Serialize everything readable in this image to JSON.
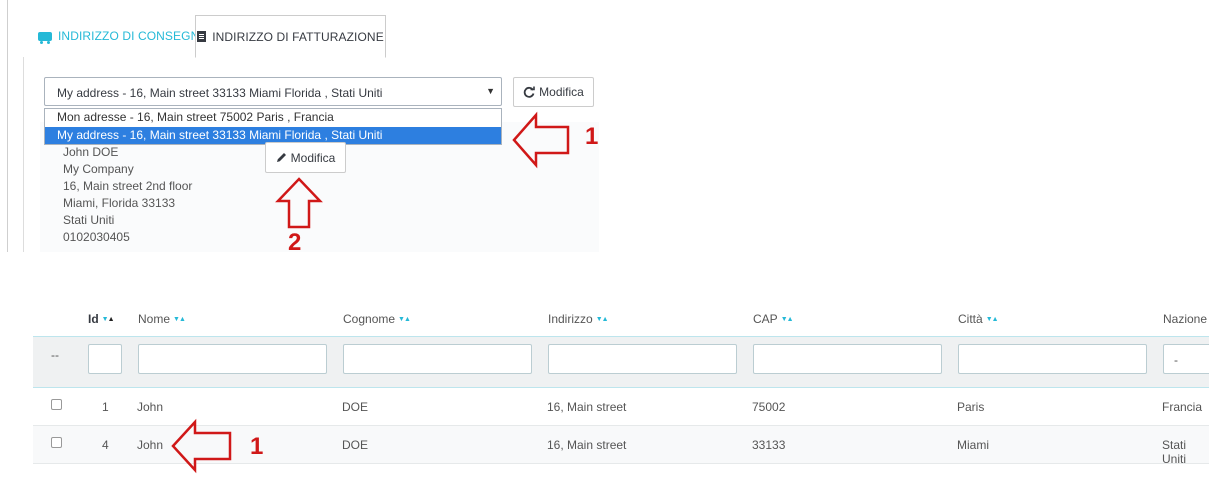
{
  "tabs": [
    {
      "label": "INDIRIZZO DI CONSEGNA",
      "icon": "truck-icon"
    },
    {
      "label": "INDIRIZZO DI FATTURAZIONE",
      "icon": "document-icon"
    }
  ],
  "address_select": {
    "selected": "My address - 16, Main street 33133 Miami Florida , Stati Uniti",
    "options": [
      "Mon adresse - 16, Main street 75002 Paris , Francia",
      "My address - 16, Main street 33133 Miami Florida , Stati Uniti"
    ]
  },
  "buttons": {
    "refresh_label": "Modifica",
    "edit_label": "Modifica"
  },
  "address_lines": [
    "John DOE",
    "My Company",
    "16, Main street 2nd floor",
    "Miami, Florida 33133",
    "Stati Uniti",
    "0102030405"
  ],
  "annotations": {
    "n1": "1",
    "n2": "2",
    "n3": "1"
  },
  "annotation_color": "#d01818",
  "table": {
    "columns": [
      "Id",
      "Nome",
      "Cognome",
      "Indirizzo",
      "CAP",
      "Città",
      "Nazione"
    ],
    "filter_placeholder_first": "--",
    "filter_select_value": "-",
    "rows": [
      {
        "id": "1",
        "nome": "John",
        "cognome": "DOE",
        "indirizzo": "16, Main street",
        "cap": "75002",
        "citta": "Paris",
        "nazione": "Francia"
      },
      {
        "id": "4",
        "nome": "John",
        "cognome": "DOE",
        "indirizzo": "16, Main street",
        "cap": "33133",
        "citta": "Miami",
        "nazione": "Stati Uniti"
      }
    ]
  },
  "colors": {
    "accent": "#25b9d7",
    "selected_option": "#2d7fe0"
  }
}
